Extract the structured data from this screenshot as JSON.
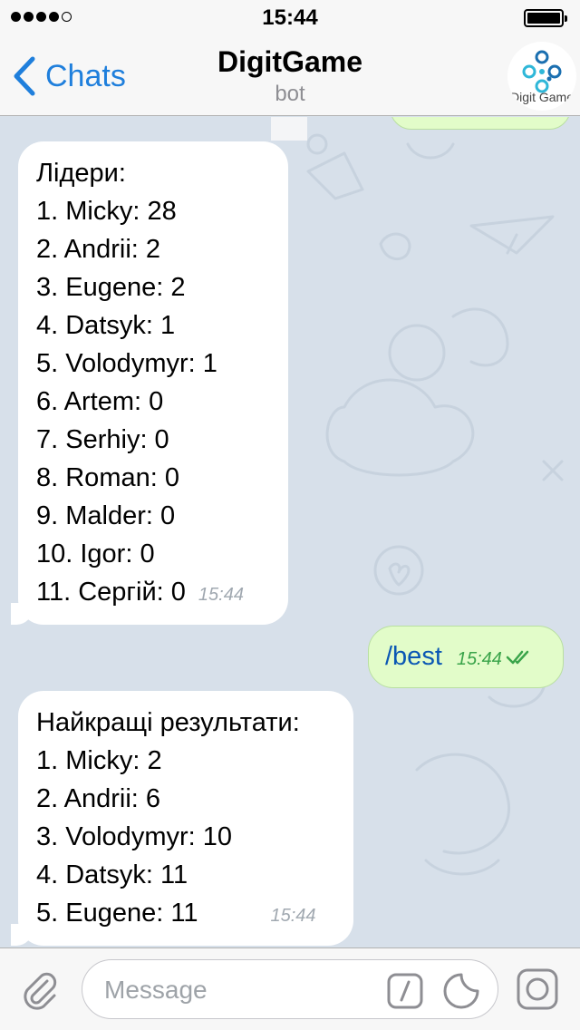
{
  "status_bar": {
    "time": "15:44"
  },
  "nav": {
    "back_label": "Chats",
    "title": "DigitGame",
    "subtitle": "bot",
    "avatar_text": "Digit Game"
  },
  "messages": [
    {
      "direction": "incoming",
      "lines": [
        "Лідери:",
        "1. Micky: 28",
        "2. Andrii: 2",
        "3. Eugene: 2",
        "4. Datsyk: 1",
        "5. Volodymyr: 1",
        "6. Artem: 0",
        "7. Serhiy: 0",
        "8. Roman: 0",
        "9. Malder: 0",
        "10. Igor: 0"
      ],
      "last_line": "11. Сергій: 0",
      "time": "15:44"
    },
    {
      "direction": "outgoing",
      "text": "/best",
      "time": "15:44",
      "status": "read"
    },
    {
      "direction": "incoming",
      "lines": [
        "Найкращі результати:",
        "1. Micky: 2",
        "2. Andrii: 6",
        "3. Volodymyr: 10",
        "4. Datsyk: 11"
      ],
      "last_line": "5. Eugene: 11",
      "time": "15:44"
    }
  ],
  "input": {
    "placeholder": "Message",
    "value": ""
  },
  "icons": {
    "attach": "paperclip-icon",
    "command": "slash-command-icon",
    "sticker": "sticker-icon",
    "camera": "camera-icon",
    "back": "chevron-left-icon"
  },
  "colors": {
    "accent": "#1f7fdc",
    "outgoing_bubble": "#e2fcc9",
    "outgoing_text": "#0b57b4",
    "read_ticks": "#3aa44a",
    "chat_background": "#d7e0ea"
  }
}
